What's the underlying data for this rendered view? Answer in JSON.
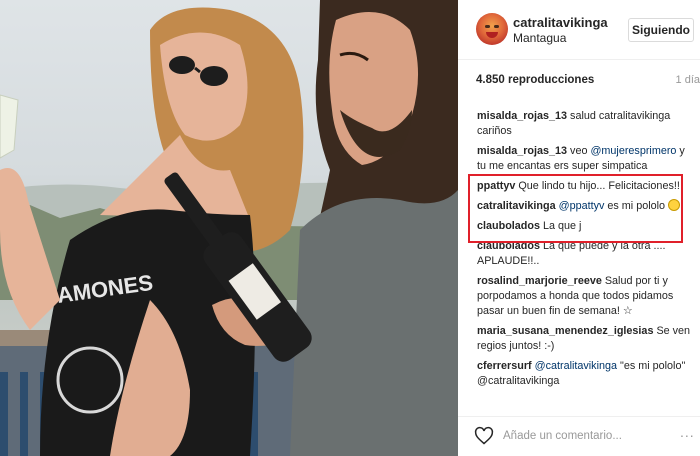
{
  "post": {
    "username": "catralitavikinga",
    "location": "Mantagua",
    "follow_label": "Siguiendo",
    "views": "4.850 reproducciones",
    "time_ago": "1 día",
    "shirt_text": "AMONES"
  },
  "comments": [
    {
      "user": "misalda_rojas_13",
      "parts": [
        {
          "t": "salud catralitavikinga cariños",
          "m": false
        }
      ]
    },
    {
      "user": "misalda_rojas_13",
      "parts": [
        {
          "t": "veo ",
          "m": false
        },
        {
          "t": "@mujeresprimero",
          "m": true
        },
        {
          "t": " y tu me encantas ers super simpatica",
          "m": false
        }
      ]
    },
    {
      "user": "ppattyv",
      "parts": [
        {
          "t": "Que lindo tu hijo... Felicitaciones!!",
          "m": false
        }
      ]
    },
    {
      "user": "catralitavikinga",
      "parts": [
        {
          "t": "@ppattyv",
          "m": true
        },
        {
          "t": " es mi pololo ",
          "m": false
        }
      ],
      "emoji": "smile-emoji"
    },
    {
      "user": "claubolados",
      "parts": [
        {
          "t": "La que j",
          "m": false
        }
      ]
    },
    {
      "user": "claubolados",
      "parts": [
        {
          "t": "La que puede y la otra .... APLAUDE!!..",
          "m": false
        }
      ]
    },
    {
      "user": "rosalind_marjorie_reeve",
      "parts": [
        {
          "t": "Salud por ti y porpodamos a honda que todos pidamos pasar un buen fin de semana! ☆",
          "m": false
        }
      ]
    },
    {
      "user": "maria_susana_menendez_iglesias",
      "parts": [
        {
          "t": "Se ven regios juntos! :-)",
          "m": false
        }
      ]
    },
    {
      "user": "cferrersurf",
      "parts": [
        {
          "t": "@catralitavikinga",
          "m": true
        },
        {
          "t": " \"es mi pololo\" @catralitavikinga",
          "m": false
        }
      ]
    }
  ],
  "footer": {
    "placeholder": "Añade un comentario...",
    "more": "..."
  },
  "colors": {
    "highlight": "#e0202a",
    "mention": "#003569",
    "text": "#262626",
    "muted": "#999999"
  }
}
